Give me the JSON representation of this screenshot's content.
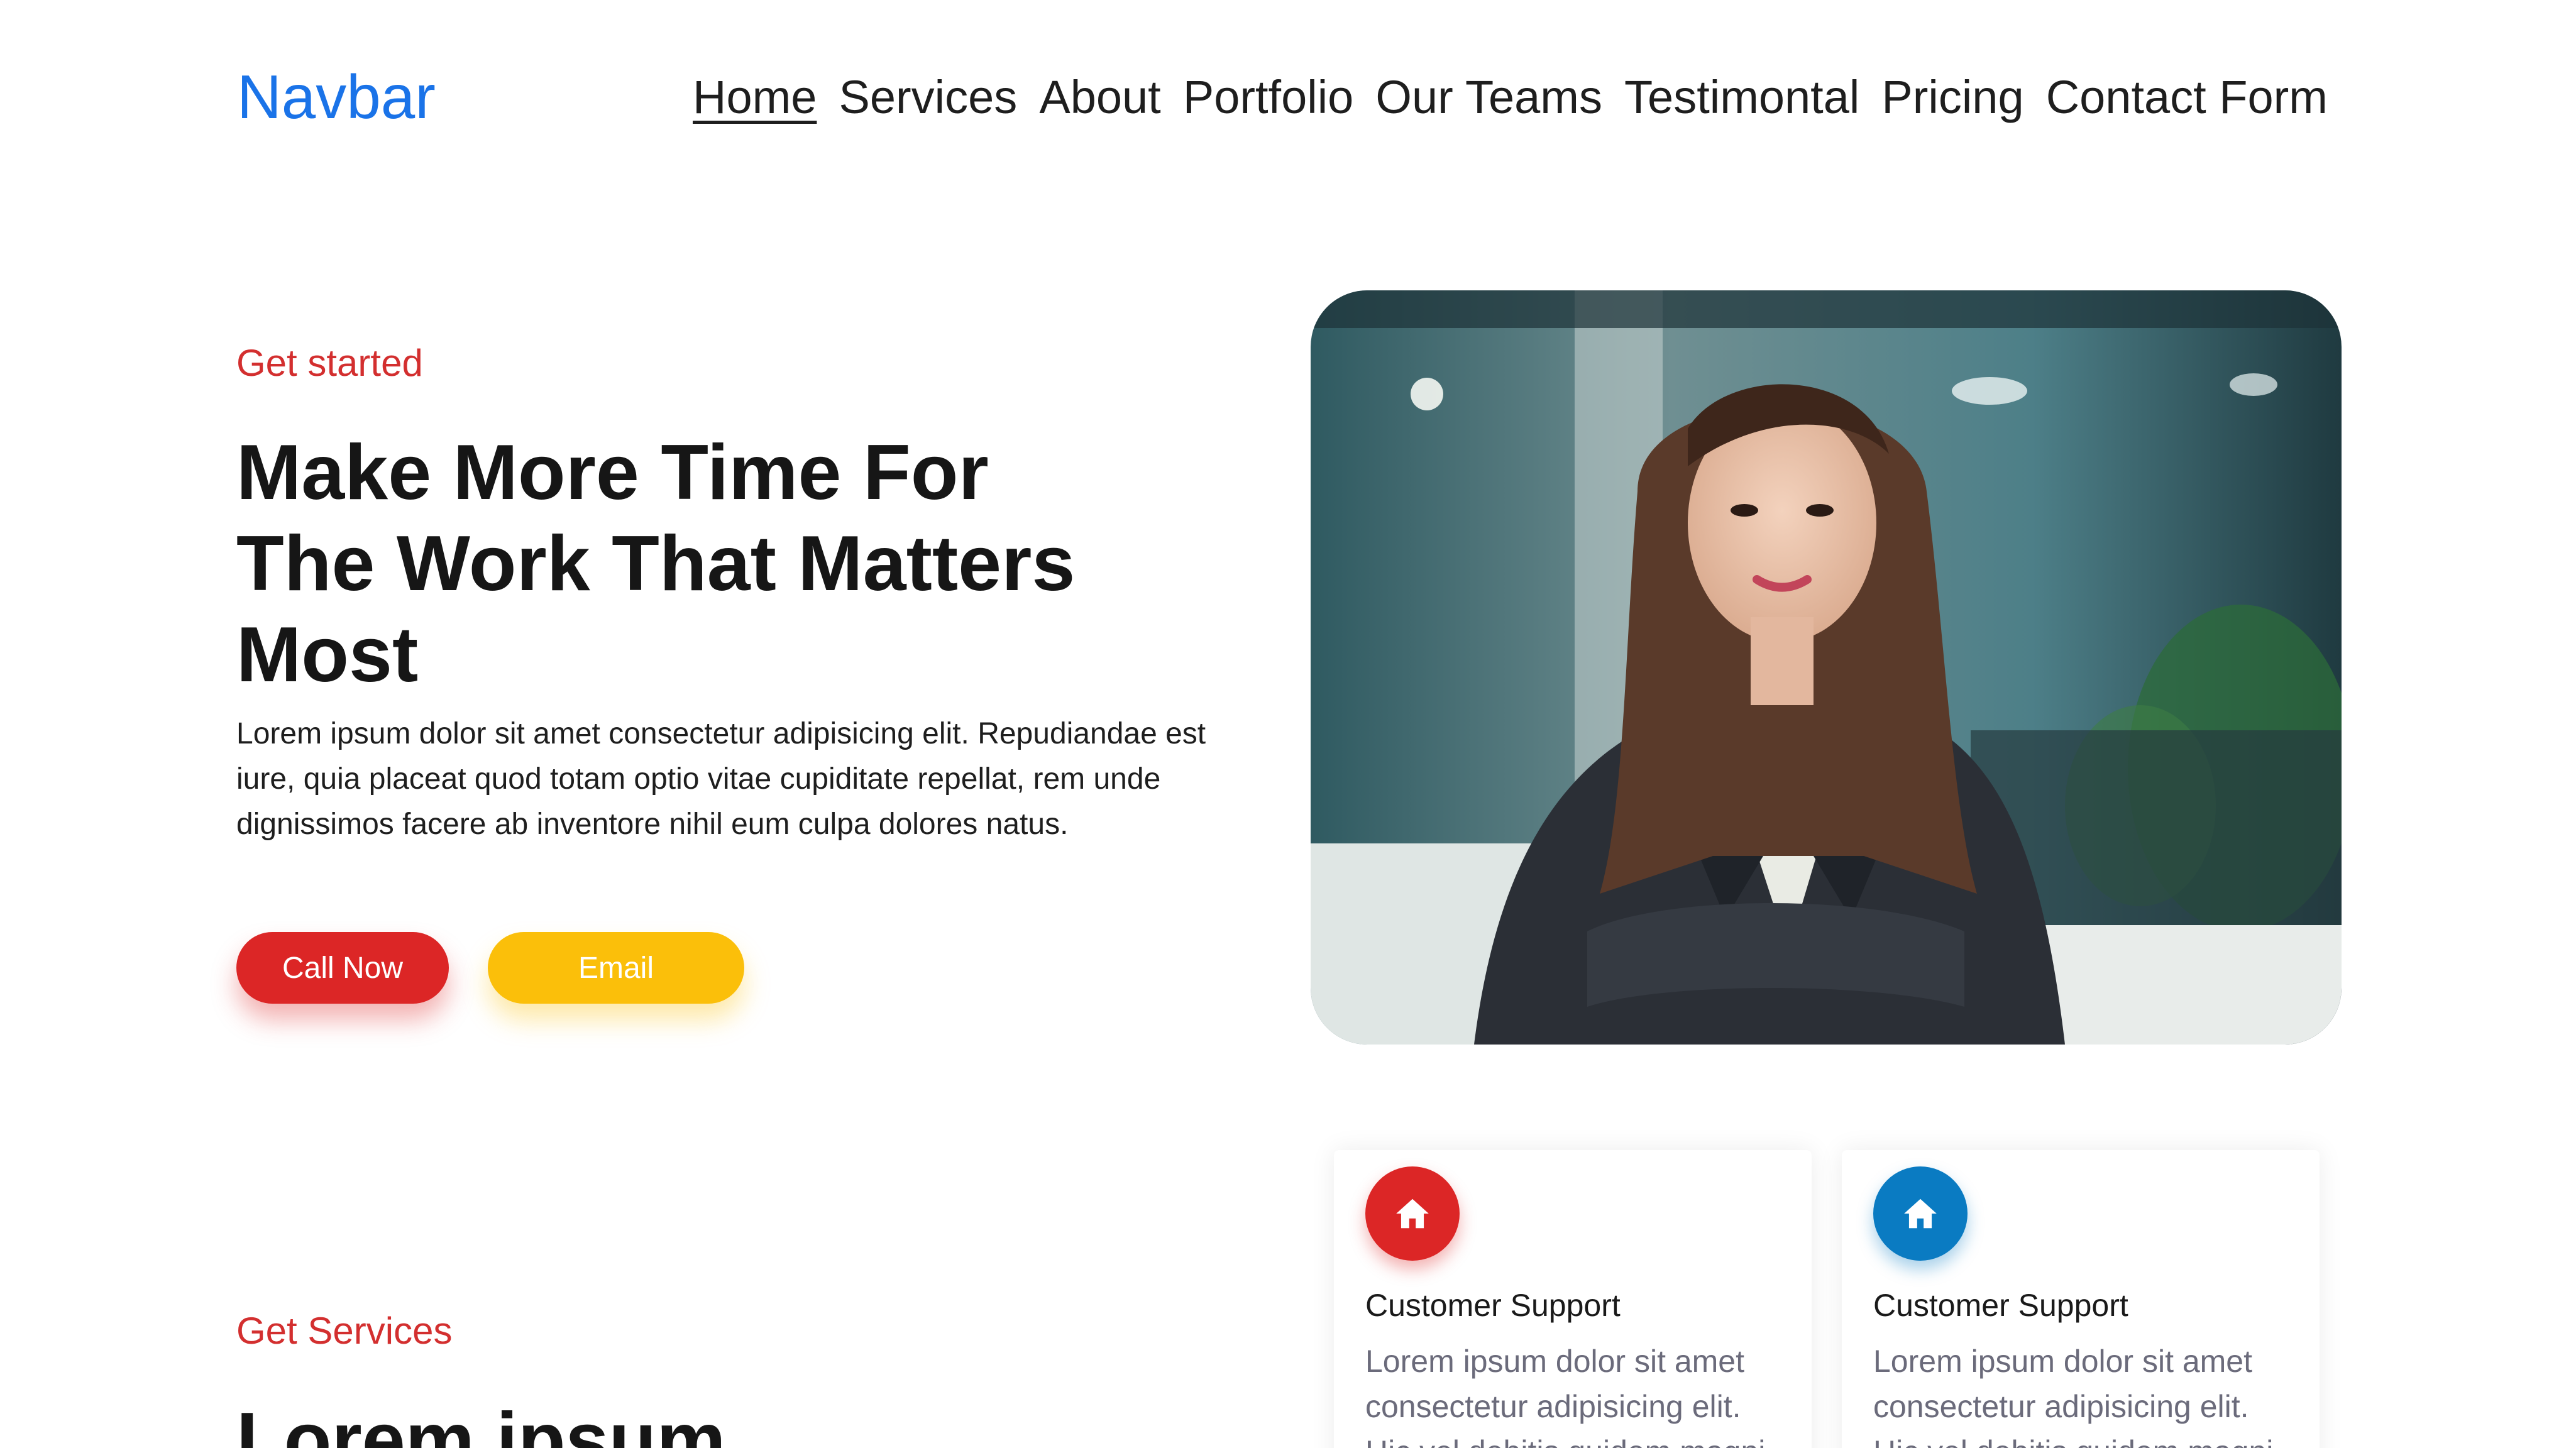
{
  "navbar": {
    "brand": "Navbar",
    "links": [
      "Home",
      "Services",
      "About",
      "Portfolio",
      "Our Teams",
      "Testimontal",
      "Pricing",
      "Contact Form"
    ]
  },
  "hero": {
    "kicker": "Get started",
    "title": "Make More Time For The Work That Matters Most",
    "text": "Lorem ipsum dolor sit amet consectetur adipisicing elit. Repudiandae est iure, quia placeat quod totam optio vitae cupiditate repellat, rem unde dignissimos facere ab inventore nihil eum culpa dolores natus.",
    "call_label": "Call Now",
    "email_label": "Email",
    "call_color": "#dc2626",
    "email_color": "#fbbf0a"
  },
  "services": {
    "kicker": "Get Services",
    "title": "Lorem ipsum",
    "cards": [
      {
        "icon": "home-icon",
        "title": "Customer Support",
        "text": "Lorem ipsum dolor sit amet consectetur adipisicing elit. Hic vel debitis quidem magni",
        "color": "#dc2626"
      },
      {
        "icon": "home-icon",
        "title": "Customer Support",
        "text": "Lorem ipsum dolor sit amet consectetur adipisicing elit. Hic vel debitis quidem magni",
        "color": "#0a7bc2"
      }
    ]
  },
  "colors": {
    "brand": "#1a73e8",
    "accent_red": "#d32f2f"
  }
}
